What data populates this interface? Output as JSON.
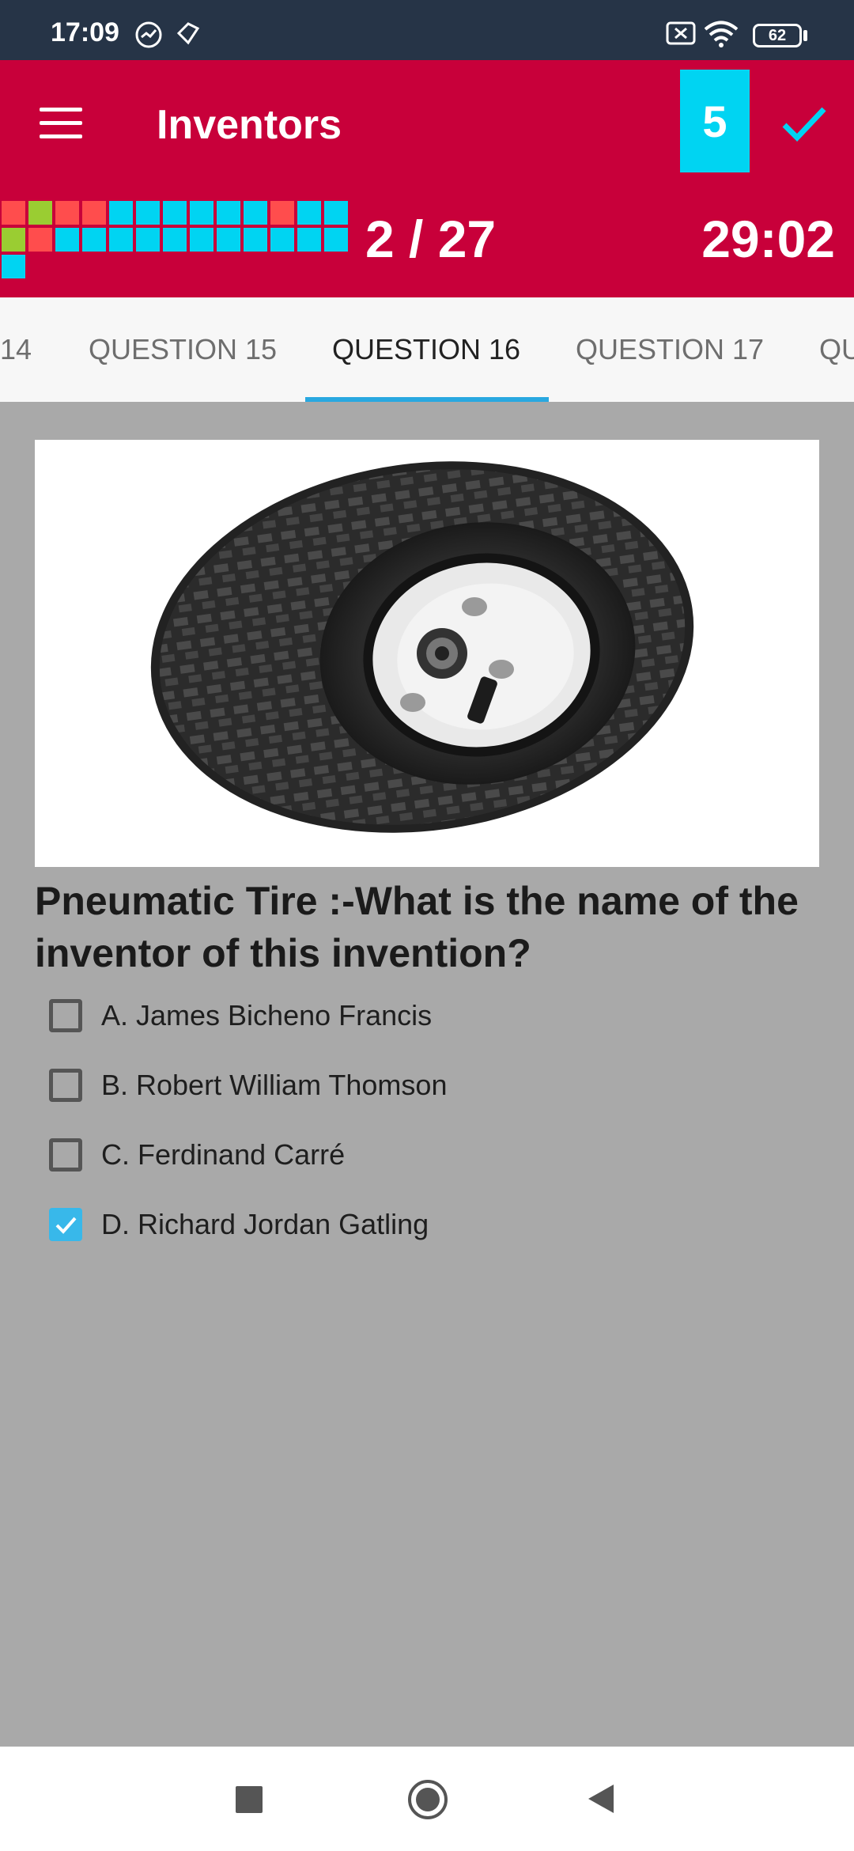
{
  "status_bar": {
    "time": "17:09",
    "battery": "62",
    "icons": [
      "clock-circle-icon",
      "messenger-icon",
      "no-sim-icon",
      "wifi-icon",
      "battery-icon"
    ]
  },
  "app_bar": {
    "title": "Inventors",
    "badge_count": "5",
    "progress_text": "2 / 27",
    "timer": "29:02",
    "colors": {
      "background": "#c8003a",
      "badge": "#00d4f2",
      "check": "#00d4f2"
    }
  },
  "progress_cells": {
    "colors": {
      "wrong": "#ff4d4d",
      "correct": "#9acd32",
      "pending": "#00d4f2"
    },
    "rows": [
      [
        "wrong",
        "correct",
        "wrong",
        "wrong",
        "pending",
        "pending",
        "pending",
        "pending",
        "pending",
        "pending",
        "wrong",
        "pending",
        "pending"
      ],
      [
        "correct",
        "wrong",
        "pending",
        "pending",
        "pending",
        "pending",
        "pending",
        "pending",
        "pending",
        "pending",
        "pending",
        "pending",
        "pending"
      ],
      [
        "pending"
      ]
    ]
  },
  "tabs": {
    "items": [
      {
        "label": "14"
      },
      {
        "label": "QUESTION 15"
      },
      {
        "label": "QUESTION 16",
        "active": true
      },
      {
        "label": "QUESTION 17"
      },
      {
        "label": "QU"
      }
    ]
  },
  "question": {
    "text": "Pneumatic Tire :-What is the name of the inventor of this invention?",
    "image_icon": "pneumatic-tire-image",
    "options": [
      {
        "label": "A. James Bicheno Francis",
        "checked": false
      },
      {
        "label": "B. Robert William Thomson",
        "checked": false
      },
      {
        "label": "C. Ferdinand Carré",
        "checked": false
      },
      {
        "label": "D. Richard Jordan Gatling",
        "checked": true
      }
    ]
  },
  "nav_bar": {
    "icons": [
      "recents-square-icon",
      "home-circle-icon",
      "back-triangle-icon"
    ]
  }
}
